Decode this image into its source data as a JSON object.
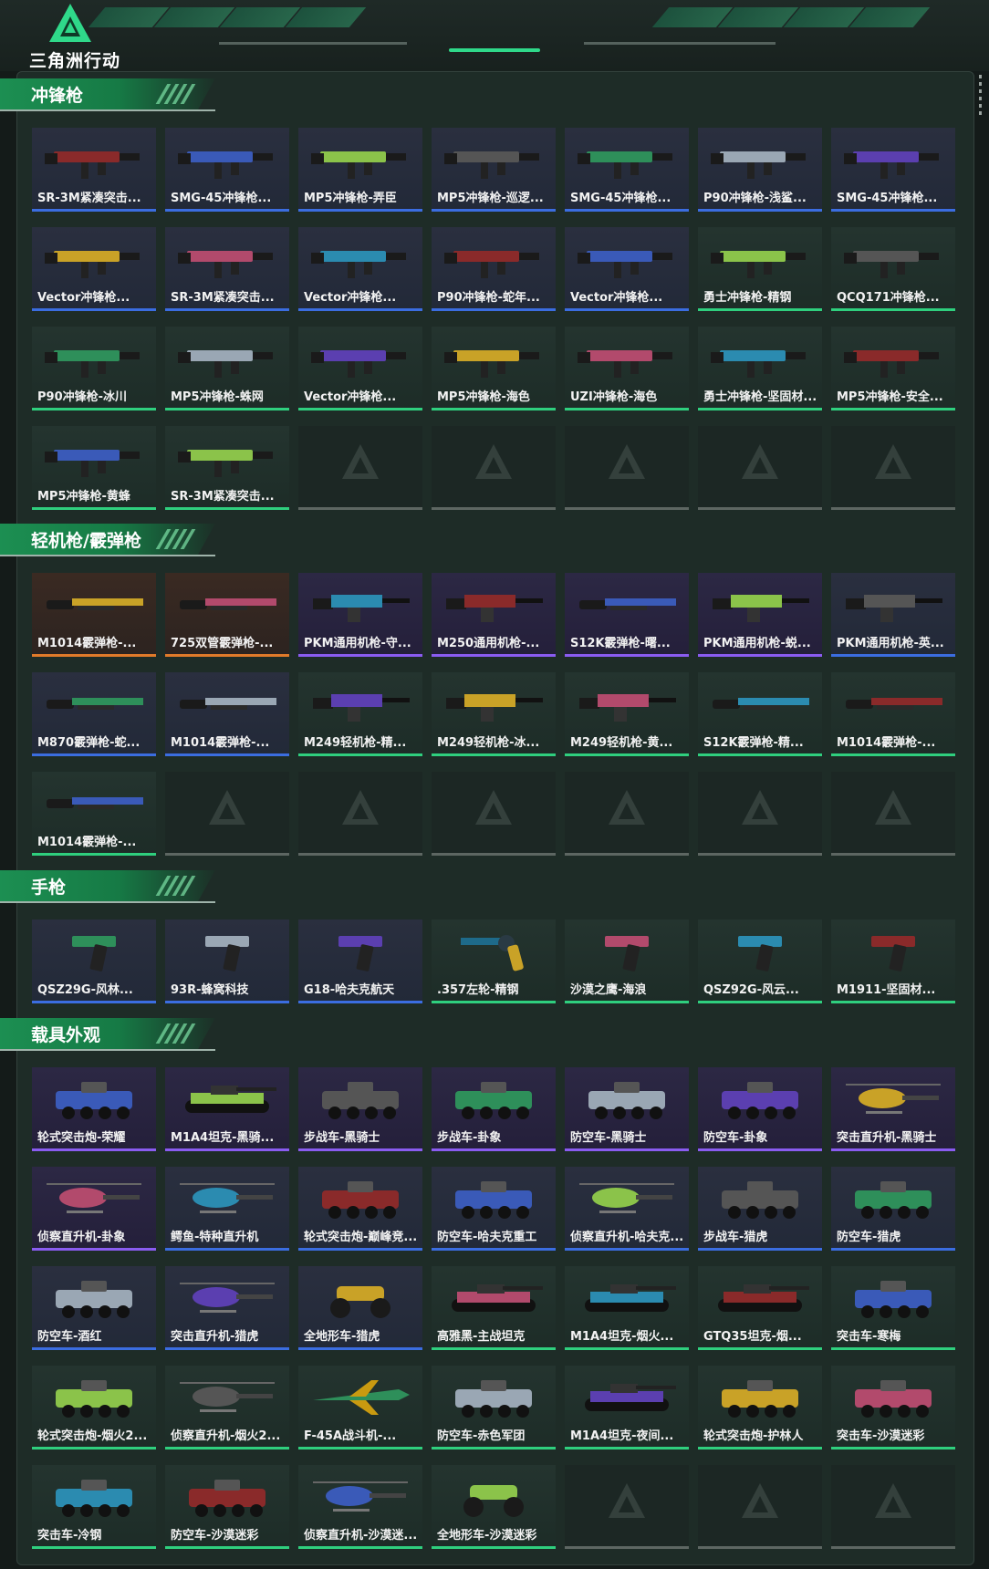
{
  "app": {
    "logo_text": "三角洲行动"
  },
  "colors": {
    "accent": "#2fd98a",
    "section_bg": "#1c8f52",
    "rarity_blue": "#3b6de0",
    "rarity_purple": "#8a5cf0",
    "rarity_green": "#2fcf7e",
    "rarity_orange": "#e07a2a"
  },
  "sections": [
    {
      "title": "冲锋枪",
      "items": [
        {
          "label": "SR-3M紧凑突击...",
          "rarity": "blue",
          "icon": "smg-icon"
        },
        {
          "label": "SMG-45冲锋枪...",
          "rarity": "blue",
          "icon": "smg-icon"
        },
        {
          "label": "MP5冲锋枪-弄臣",
          "rarity": "blue",
          "icon": "smg-icon"
        },
        {
          "label": "MP5冲锋枪-巡逻...",
          "rarity": "blue",
          "icon": "smg-icon"
        },
        {
          "label": "SMG-45冲锋枪...",
          "rarity": "blue",
          "icon": "smg-icon"
        },
        {
          "label": "P90冲锋枪-浅鲨...",
          "rarity": "blue",
          "icon": "smg-icon"
        },
        {
          "label": "SMG-45冲锋枪...",
          "rarity": "blue",
          "icon": "smg-icon"
        },
        {
          "label": "Vector冲锋枪...",
          "rarity": "blue",
          "icon": "smg-icon"
        },
        {
          "label": "SR-3M紧凑突击...",
          "rarity": "blue",
          "icon": "smg-icon"
        },
        {
          "label": "Vector冲锋枪...",
          "rarity": "blue",
          "icon": "smg-icon"
        },
        {
          "label": "P90冲锋枪-蛇年...",
          "rarity": "blue",
          "icon": "smg-icon"
        },
        {
          "label": "Vector冲锋枪...",
          "rarity": "blue",
          "icon": "smg-icon"
        },
        {
          "label": "勇士冲锋枪-精钢",
          "rarity": "green",
          "icon": "smg-icon"
        },
        {
          "label": "QCQ171冲锋枪...",
          "rarity": "green",
          "icon": "smg-icon"
        },
        {
          "label": "P90冲锋枪-冰川",
          "rarity": "green",
          "icon": "smg-icon"
        },
        {
          "label": "MP5冲锋枪-蛛网",
          "rarity": "green",
          "icon": "smg-icon"
        },
        {
          "label": "Vector冲锋枪...",
          "rarity": "green",
          "icon": "smg-icon"
        },
        {
          "label": "MP5冲锋枪-海色",
          "rarity": "green",
          "icon": "smg-icon"
        },
        {
          "label": "UZI冲锋枪-海色",
          "rarity": "green",
          "icon": "smg-icon"
        },
        {
          "label": "勇士冲锋枪-坚固材...",
          "rarity": "green",
          "icon": "smg-icon"
        },
        {
          "label": "MP5冲锋枪-安全...",
          "rarity": "green",
          "icon": "smg-icon"
        },
        {
          "label": "MP5冲锋枪-黄蜂",
          "rarity": "green",
          "icon": "smg-icon"
        },
        {
          "label": "SR-3M紧凑突击...",
          "rarity": "green",
          "icon": "smg-icon"
        },
        {
          "empty": true
        },
        {
          "empty": true
        },
        {
          "empty": true
        },
        {
          "empty": true
        },
        {
          "empty": true
        }
      ]
    },
    {
      "title": "轻机枪/霰弹枪",
      "items": [
        {
          "label": "M1014霰弹枪-...",
          "rarity": "orange",
          "icon": "shotgun-icon"
        },
        {
          "label": "725双管霰弹枪-...",
          "rarity": "orange",
          "icon": "shotgun-icon"
        },
        {
          "label": "PKM通用机枪-守...",
          "rarity": "purple",
          "icon": "lmg-icon"
        },
        {
          "label": "M250通用机枪-...",
          "rarity": "purple",
          "icon": "lmg-icon"
        },
        {
          "label": "S12K霰弹枪-曙...",
          "rarity": "purple",
          "icon": "shotgun-icon"
        },
        {
          "label": "PKM通用机枪-蜕...",
          "rarity": "purple",
          "icon": "lmg-icon"
        },
        {
          "label": "PKM通用机枪-英...",
          "rarity": "blue",
          "icon": "lmg-icon"
        },
        {
          "label": "M870霰弹枪-蛇...",
          "rarity": "blue",
          "icon": "shotgun-icon"
        },
        {
          "label": "M1014霰弹枪-...",
          "rarity": "blue",
          "icon": "shotgun-icon"
        },
        {
          "label": "M249轻机枪-精...",
          "rarity": "green",
          "icon": "lmg-icon"
        },
        {
          "label": "M249轻机枪-冰...",
          "rarity": "green",
          "icon": "lmg-icon"
        },
        {
          "label": "M249轻机枪-黄...",
          "rarity": "green",
          "icon": "lmg-icon"
        },
        {
          "label": "S12K霰弹枪-精...",
          "rarity": "green",
          "icon": "shotgun-icon"
        },
        {
          "label": "M1014霰弹枪-...",
          "rarity": "green",
          "icon": "shotgun-icon"
        },
        {
          "label": "M1014霰弹枪-...",
          "rarity": "green",
          "icon": "shotgun-icon"
        },
        {
          "empty": true
        },
        {
          "empty": true
        },
        {
          "empty": true
        },
        {
          "empty": true
        },
        {
          "empty": true
        },
        {
          "empty": true
        }
      ]
    },
    {
      "title": "手枪",
      "items": [
        {
          "label": "QSZ29G-风林...",
          "rarity": "blue",
          "icon": "pistol-icon"
        },
        {
          "label": "93R-蜂窝科技",
          "rarity": "blue",
          "icon": "pistol-icon"
        },
        {
          "label": "G18-哈夫克航天",
          "rarity": "blue",
          "icon": "pistol-icon"
        },
        {
          "label": ".357左轮-精钢",
          "rarity": "green",
          "icon": "revolver-icon"
        },
        {
          "label": "沙漠之鹰-海浪",
          "rarity": "green",
          "icon": "pistol-icon"
        },
        {
          "label": "QSZ92G-风云...",
          "rarity": "green",
          "icon": "pistol-icon"
        },
        {
          "label": "M1911-坚固材...",
          "rarity": "green",
          "icon": "pistol-icon"
        }
      ]
    },
    {
      "title": "载具外观",
      "items": [
        {
          "label": "轮式突击炮-荣耀",
          "rarity": "purple",
          "icon": "vehicle-icon"
        },
        {
          "label": "M1A4坦克-黑骑...",
          "rarity": "purple",
          "icon": "tank-icon"
        },
        {
          "label": "步战车-黑骑士",
          "rarity": "purple",
          "icon": "vehicle-icon"
        },
        {
          "label": "步战车-卦象",
          "rarity": "purple",
          "icon": "vehicle-icon"
        },
        {
          "label": "防空车-黑骑士",
          "rarity": "purple",
          "icon": "vehicle-icon"
        },
        {
          "label": "防空车-卦象",
          "rarity": "purple",
          "icon": "vehicle-icon"
        },
        {
          "label": "突击直升机-黑骑士",
          "rarity": "purple",
          "icon": "helicopter-icon"
        },
        {
          "label": "侦察直升机-卦象",
          "rarity": "purple",
          "icon": "helicopter-icon"
        },
        {
          "label": "鳄鱼-特种直升机",
          "rarity": "blue",
          "icon": "helicopter-icon"
        },
        {
          "label": "轮式突击炮-巅峰竞...",
          "rarity": "blue",
          "icon": "vehicle-icon"
        },
        {
          "label": "防空车-哈夫克重工",
          "rarity": "blue",
          "icon": "vehicle-icon"
        },
        {
          "label": "侦察直升机-哈夫克...",
          "rarity": "blue",
          "icon": "helicopter-icon"
        },
        {
          "label": "步战车-猎虎",
          "rarity": "blue",
          "icon": "vehicle-icon"
        },
        {
          "label": "防空车-猎虎",
          "rarity": "blue",
          "icon": "vehicle-icon"
        },
        {
          "label": "防空车-酒红",
          "rarity": "blue",
          "icon": "vehicle-icon"
        },
        {
          "label": "突击直升机-猎虎",
          "rarity": "blue",
          "icon": "helicopter-icon"
        },
        {
          "label": "全地形车-猎虎",
          "rarity": "blue",
          "icon": "atv-icon"
        },
        {
          "label": "高雅黑-主战坦克",
          "rarity": "green",
          "icon": "tank-icon"
        },
        {
          "label": "M1A4坦克-烟火...",
          "rarity": "green",
          "icon": "tank-icon"
        },
        {
          "label": "GTQ35坦克-烟...",
          "rarity": "green",
          "icon": "tank-icon"
        },
        {
          "label": "突击车-寒梅",
          "rarity": "green",
          "icon": "vehicle-icon"
        },
        {
          "label": "轮式突击炮-烟火2...",
          "rarity": "green",
          "icon": "vehicle-icon"
        },
        {
          "label": "侦察直升机-烟火2...",
          "rarity": "green",
          "icon": "helicopter-icon"
        },
        {
          "label": "F-45A战斗机-...",
          "rarity": "green",
          "icon": "jet-icon"
        },
        {
          "label": "防空车-赤色军团",
          "rarity": "green",
          "icon": "vehicle-icon"
        },
        {
          "label": "M1A4坦克-夜间...",
          "rarity": "green",
          "icon": "tank-icon"
        },
        {
          "label": "轮式突击炮-护林人",
          "rarity": "green",
          "icon": "vehicle-icon"
        },
        {
          "label": "突击车-沙漠迷彩",
          "rarity": "green",
          "icon": "vehicle-icon"
        },
        {
          "label": "突击车-冷钢",
          "rarity": "green",
          "icon": "vehicle-icon"
        },
        {
          "label": "防空车-沙漠迷彩",
          "rarity": "green",
          "icon": "vehicle-icon"
        },
        {
          "label": "侦察直升机-沙漠迷...",
          "rarity": "green",
          "icon": "helicopter-icon"
        },
        {
          "label": "全地形车-沙漠迷彩",
          "rarity": "green",
          "icon": "atv-icon"
        },
        {
          "empty": true
        },
        {
          "empty": true
        },
        {
          "empty": true
        }
      ]
    }
  ]
}
